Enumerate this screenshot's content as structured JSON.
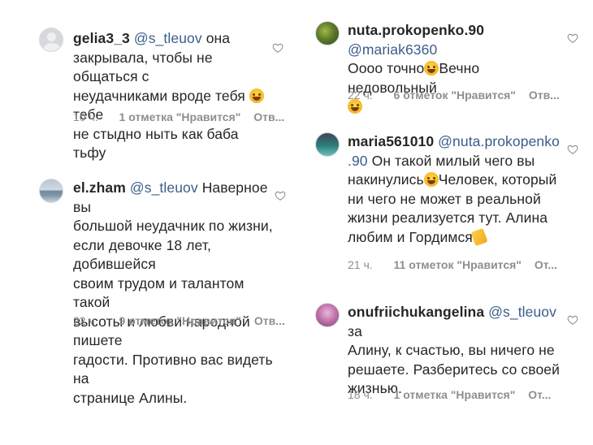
{
  "comments": [
    {
      "username": "gelia3_3",
      "mention": "@s_tleuov",
      "lines": [
        "она",
        "закрывала, чтобы не общаться с",
        "неудачниками вроде тебя",
        "тебе",
        "не стыдно ныть как баба тьфу"
      ],
      "time": "10 ч.",
      "likes": "1 отметка \"Нравится\"",
      "reply": "Отв..."
    },
    {
      "username": "el.zham",
      "mention": "@s_tleuov",
      "lines": [
        "Наверное вы",
        "большой неудачник по жизни,",
        "если девочке 18 лет,  добившейся",
        "своим трудом и талантом такой",
        "высоты и любви народной пишете",
        "гадости. Противно вас видеть на",
        "странице Алины."
      ],
      "time": "22 ч.",
      "likes": "9 отметок \"Нравится\"",
      "reply": "Отв..."
    },
    {
      "username": "nuta.prokopenko.90",
      "mention": "@mariak6360",
      "lines": [
        "Оооо точно",
        "Вечно недовольный"
      ],
      "time": "22 ч.",
      "likes": "6 отметок \"Нравится\"",
      "reply": "Отв..."
    },
    {
      "username": "maria561010",
      "mention_a": "@nuta.prokopenko",
      "mention_b": ".90",
      "lines": [
        "Он такой милый чего вы",
        "накинулись",
        "Человек, который",
        "ни чего не может в реальной",
        "жизни реализуется тут. Алина",
        "любим и Гордимся"
      ],
      "time": "21 ч.",
      "likes": "11 отметок \"Нравится\"",
      "reply": "От..."
    },
    {
      "username": "onufriichukangelina",
      "mention": "@s_tleuov",
      "lines": [
        "за",
        "Алину, к счастью, вы ничего не",
        "решаете. Разберитесь со своей",
        "жизнью."
      ],
      "time": "18 ч.",
      "likes": "1 отметка \"Нравится\"",
      "reply": "От..."
    }
  ],
  "icons": {
    "heart": "heart-outline-icon",
    "emoji_laugh": "grinning-face-emoji",
    "emoji_clap": "clapping-hands-emoji"
  },
  "colors": {
    "text": "#262626",
    "mention": "#3b5d8a",
    "meta": "#8e8e8e"
  }
}
